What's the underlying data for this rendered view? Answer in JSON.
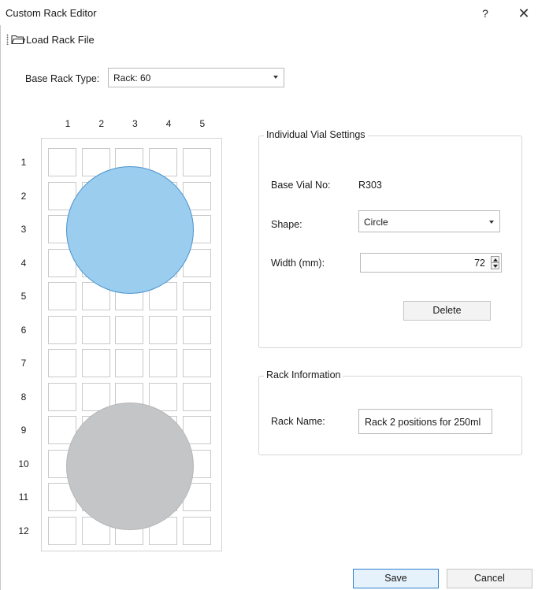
{
  "window": {
    "title": "Custom Rack Editor",
    "help_label": "?",
    "close_label": "✕"
  },
  "toolbar": {
    "load_label": "Load Rack File",
    "load_icon": "folder-open-icon"
  },
  "base_rack": {
    "label": "Base Rack Type:",
    "value": "Rack: 60"
  },
  "rack_grid": {
    "columns": [
      "1",
      "2",
      "3",
      "4",
      "5"
    ],
    "rows": [
      "1",
      "2",
      "3",
      "4",
      "5",
      "6",
      "7",
      "8",
      "9",
      "10",
      "11",
      "12"
    ],
    "vials": [
      {
        "name": "selected-vial",
        "color": "#9acdee",
        "border": "#4a93cf",
        "selected": true
      },
      {
        "name": "vial",
        "color": "#c3c5c6",
        "border": "#b4b6b7",
        "selected": false
      }
    ]
  },
  "individual_vial_settings": {
    "title": "Individual Vial Settings",
    "base_vial_label": "Base Vial No:",
    "base_vial_value": "R303",
    "shape_label": "Shape:",
    "shape_value": "Circle",
    "width_label": "Width (mm):",
    "width_value": "72",
    "delete_label": "Delete"
  },
  "rack_information": {
    "title": "Rack Information",
    "rack_name_label": "Rack Name:",
    "rack_name_value": "Rack 2 positions for 250ml"
  },
  "footer": {
    "save_label": "Save",
    "cancel_label": "Cancel"
  },
  "colors": {
    "accent": "#2f7fd0",
    "selected_vial": "#9acdee",
    "vial": "#c3c5c6"
  }
}
